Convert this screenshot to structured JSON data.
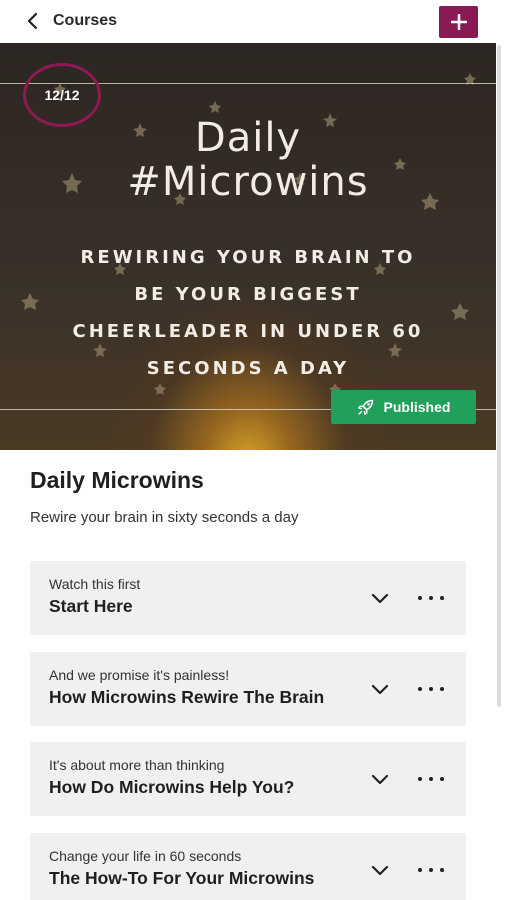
{
  "header": {
    "back_icon": "chevron-left-icon",
    "title": "Courses",
    "add_icon": "plus-icon",
    "accent": "#8a1a52"
  },
  "hero": {
    "counter": "12/12",
    "title_line1": "Daily",
    "title_line2": "#Microwins",
    "subtitle_lines": [
      "REWIRING YOUR BRAIN TO",
      "BE YOUR BIGGEST",
      "CHEERLEADER IN UNDER 60",
      "SECONDS A DAY"
    ],
    "status_label": "Published",
    "status_icon": "rocket-icon",
    "status_color": "#20a05a"
  },
  "course": {
    "title": "Daily Microwins",
    "description": "Rewire your brain in sixty seconds a day"
  },
  "sections": [
    {
      "subtitle": "Watch this first",
      "title": "Start Here"
    },
    {
      "subtitle": "And we promise it's painless!",
      "title": "How Microwins Rewire The Brain"
    },
    {
      "subtitle": "It's about more than thinking",
      "title": "How Do Microwins Help You?"
    },
    {
      "subtitle": "Change your life in 60 seconds",
      "title": "The How-To For Your Microwins"
    }
  ]
}
